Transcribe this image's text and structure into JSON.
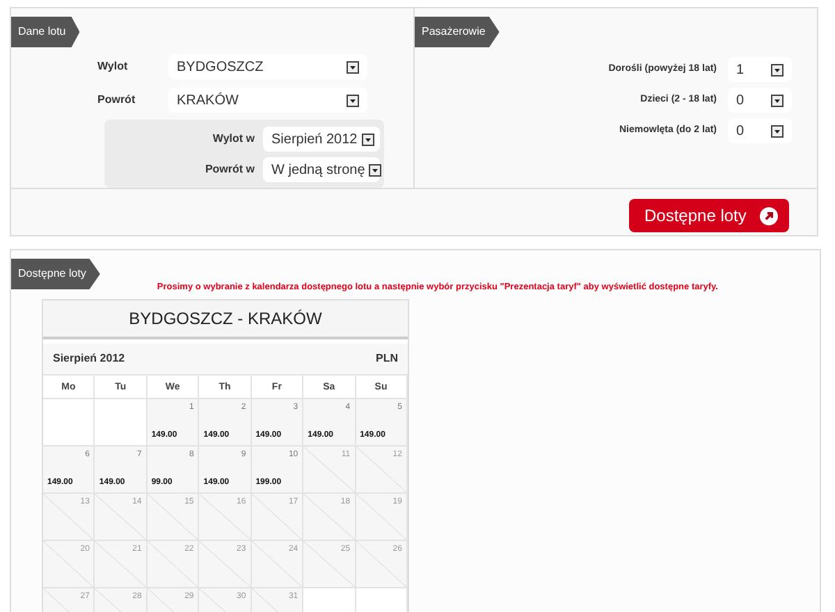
{
  "flight_data": {
    "title": "Dane lotu",
    "fields": [
      {
        "label": "Wylot",
        "value": "BYDGOSZCZ"
      },
      {
        "label": "Powrót",
        "value": "KRAKÓW"
      }
    ],
    "dates": [
      {
        "label": "Wylot w",
        "value": "Sierpień 2012"
      },
      {
        "label": "Powrót w",
        "value": "W jedną stronę"
      }
    ]
  },
  "passengers": {
    "title": "Pasażerowie",
    "fields": [
      {
        "label": "Dorośli (powyżej 18 lat)",
        "value": "1"
      },
      {
        "label": "Dzieci (2 - 18 lat)",
        "value": "0"
      },
      {
        "label": "Niemowlęta (do 2 lat)",
        "value": "0"
      }
    ]
  },
  "search_button": {
    "label": "Dostępne loty"
  },
  "available_flights": {
    "title": "Dostępne loty",
    "message": "Prosimy o wybranie z kalendarza dostępnego lotu a następnie wybór przycisku **\"Prezentacja taryf\"** aby wyświetlić dostępne taryfy.",
    "calendar": {
      "route": "BYDGOSZCZ - KRAKÓW",
      "month": "Sierpień 2012",
      "currency": "PLN",
      "weekdays": [
        "Mo",
        "Tu",
        "We",
        "Th",
        "Fr",
        "Sa",
        "Su"
      ],
      "weeks": [
        [
          {
            "kind": "blank"
          },
          {
            "kind": "blank"
          },
          {
            "kind": "available",
            "day": "1",
            "price": "149.00"
          },
          {
            "kind": "available",
            "day": "2",
            "price": "149.00"
          },
          {
            "kind": "available",
            "day": "3",
            "price": "149.00"
          },
          {
            "kind": "available",
            "day": "4",
            "price": "149.00"
          },
          {
            "kind": "available",
            "day": "5",
            "price": "149.00"
          }
        ],
        [
          {
            "kind": "available",
            "day": "6",
            "price": "149.00"
          },
          {
            "kind": "available",
            "day": "7",
            "price": "149.00"
          },
          {
            "kind": "available",
            "day": "8",
            "price": "99.00"
          },
          {
            "kind": "available",
            "day": "9",
            "price": "149.00"
          },
          {
            "kind": "available",
            "day": "10",
            "price": "199.00"
          },
          {
            "kind": "unavailable",
            "day": "11"
          },
          {
            "kind": "unavailable",
            "day": "12"
          }
        ],
        [
          {
            "kind": "unavailable",
            "day": "13"
          },
          {
            "kind": "unavailable",
            "day": "14"
          },
          {
            "kind": "unavailable",
            "day": "15"
          },
          {
            "kind": "unavailable",
            "day": "16"
          },
          {
            "kind": "unavailable",
            "day": "17"
          },
          {
            "kind": "unavailable",
            "day": "18"
          },
          {
            "kind": "unavailable",
            "day": "19"
          }
        ],
        [
          {
            "kind": "unavailable",
            "day": "20"
          },
          {
            "kind": "unavailable",
            "day": "21"
          },
          {
            "kind": "unavailable",
            "day": "22"
          },
          {
            "kind": "unavailable",
            "day": "23"
          },
          {
            "kind": "unavailable",
            "day": "24"
          },
          {
            "kind": "unavailable",
            "day": "25"
          },
          {
            "kind": "unavailable",
            "day": "26"
          }
        ],
        [
          {
            "kind": "unavailable",
            "day": "27"
          },
          {
            "kind": "unavailable",
            "day": "28"
          },
          {
            "kind": "unavailable",
            "day": "29"
          },
          {
            "kind": "unavailable",
            "day": "30"
          },
          {
            "kind": "unavailable",
            "day": "31"
          },
          {
            "kind": "blank"
          },
          {
            "kind": "blank"
          }
        ]
      ]
    }
  }
}
